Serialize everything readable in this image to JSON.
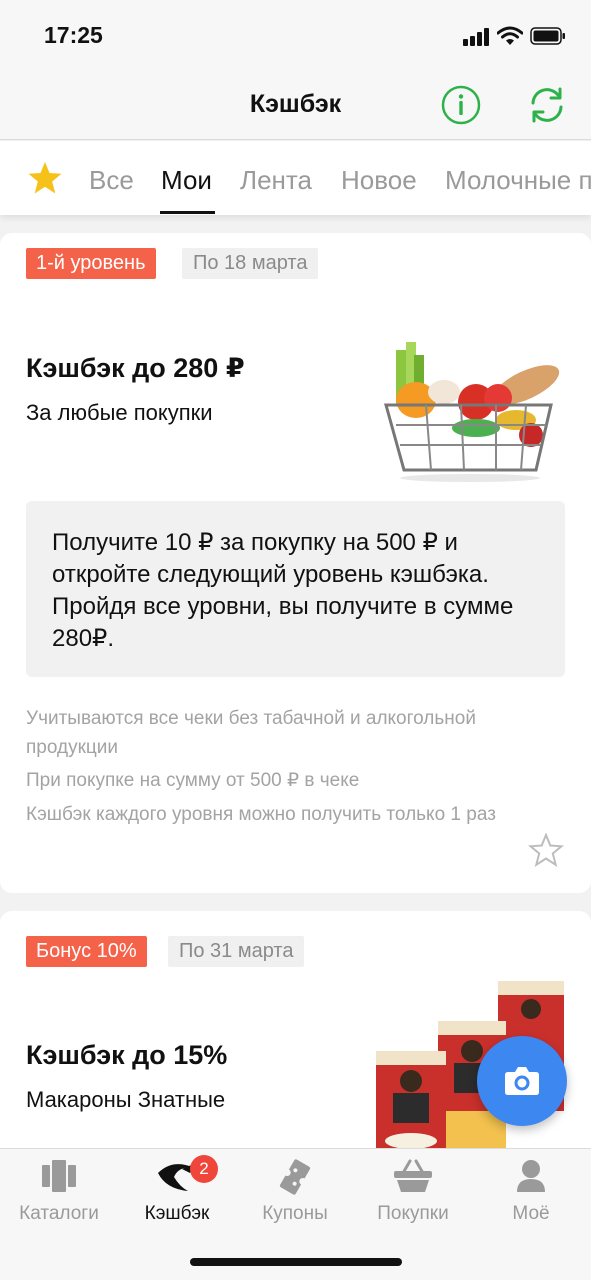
{
  "status_bar": {
    "time": "17:25"
  },
  "header": {
    "title": "Кэшбэк"
  },
  "tabs": [
    {
      "label": "Все"
    },
    {
      "label": "Мои"
    },
    {
      "label": "Лента"
    },
    {
      "label": "Новое"
    },
    {
      "label": "Молочные п"
    }
  ],
  "active_tab": "Мои",
  "cards": [
    {
      "badge": "1-й уровень",
      "date": "По 18 марта",
      "title": "Кэшбэк до 280 ₽",
      "subtitle": "За любые покупки",
      "info": "Получите 10 ₽ за покупку на 500 ₽ и откройте следующий уровень кэшбэка. Пройдя все уровни, вы получите в сумме 280₽.",
      "conditions": [
        "Учитываются все чеки без табачной и алкогольной продукции",
        "При покупке на сумму от 500 ₽ в чеке",
        "Кэшбэк каждого уровня можно получить только 1 раз"
      ]
    },
    {
      "badge": "Бонус 10%",
      "date": "По 31 марта",
      "title": "Кэшбэк до 15%",
      "subtitle": "Макароны Знатные"
    }
  ],
  "bottom_nav": [
    {
      "label": "Каталоги",
      "icon": "catalogs-icon"
    },
    {
      "label": "Кэшбэк",
      "icon": "cashback-icon",
      "badge": "2"
    },
    {
      "label": "Купоны",
      "icon": "coupons-icon"
    },
    {
      "label": "Покупки",
      "icon": "basket-icon"
    },
    {
      "label": "Моё",
      "icon": "profile-icon"
    }
  ],
  "colors": {
    "accent_green": "#2db24a",
    "badge_red": "#f4624a",
    "fab_blue": "#3d87f0",
    "star_yellow": "#f6c21a"
  }
}
